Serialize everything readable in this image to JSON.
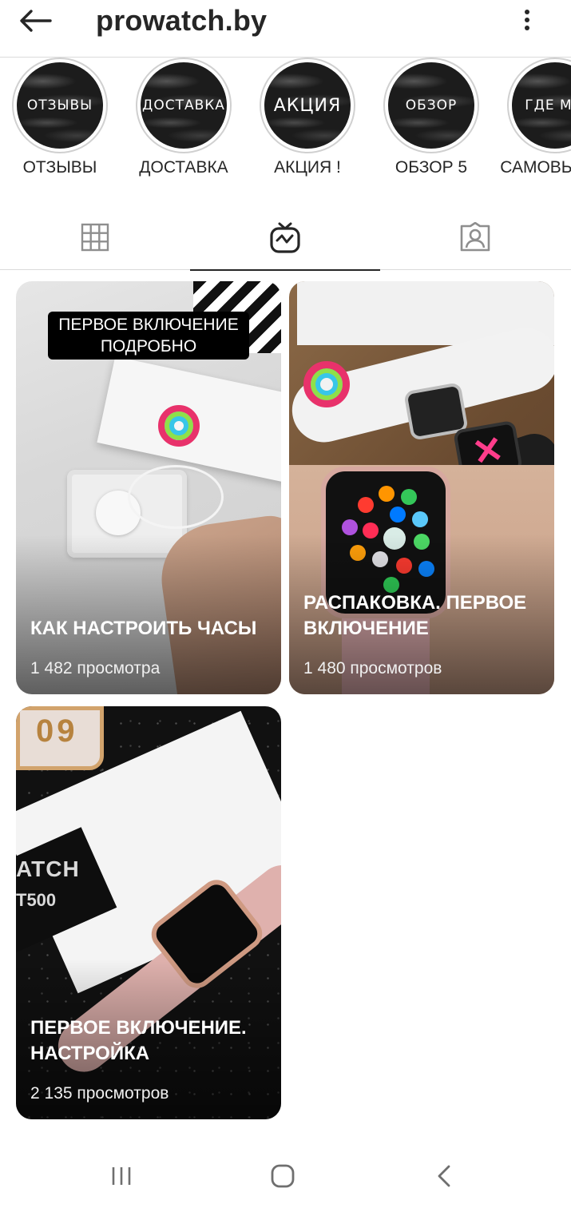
{
  "header": {
    "title": "prowatch.by",
    "back_icon": "arrow-left-icon",
    "menu_icon": "more-vertical-icon"
  },
  "highlights": [
    {
      "cover_text": "ОТЗЫВЫ",
      "label": "ОТЗЫВЫ"
    },
    {
      "cover_text": "ДОСТАВКА",
      "label": "ДОСТАВКА"
    },
    {
      "cover_text": "АКЦИЯ",
      "label": "АКЦИЯ !"
    },
    {
      "cover_text": "ОБЗОР",
      "label": "ОБЗОР 5"
    },
    {
      "cover_text": "ГДЕ МЫ",
      "label": "САМОВЫВОЗ"
    }
  ],
  "tabs": [
    {
      "icon": "grid-icon",
      "active": false
    },
    {
      "icon": "igtv-icon",
      "active": true
    },
    {
      "icon": "tagged-icon",
      "active": false
    }
  ],
  "videos": [
    {
      "caption_tag": "ПЕРВОЕ ВКЛЮЧЕНИЕ ПОДРОБНО",
      "title": "КАК НАСТРОИТЬ ЧАСЫ",
      "views": "1 482 просмотра"
    },
    {
      "title": "РАСПАКОВКА. ПЕРВОЕ ВКЛЮЧЕНИЕ",
      "views": "1 480 просмотров"
    },
    {
      "title": "ПЕРВОЕ ВКЛЮЧЕНИЕ. НАСТРОЙКА",
      "views": "2 135 просмотров",
      "box_text": "ATCH",
      "box_text2": "T500",
      "watch_face_text": "09"
    }
  ],
  "system_nav": {
    "recents_icon": "recents-icon",
    "home_icon": "home-icon",
    "back_icon": "back-chevron-icon"
  },
  "colors": {
    "text": "#262626",
    "divider": "#dbdbdb",
    "background": "#ffffff"
  }
}
